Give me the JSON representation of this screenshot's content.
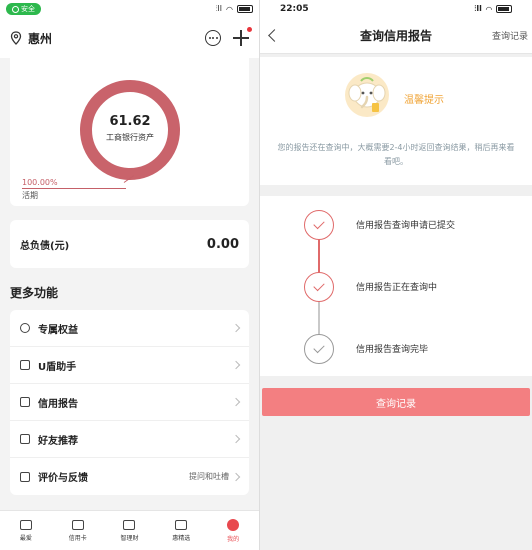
{
  "left": {
    "status": {
      "badge": "安全",
      "signal": "⫶ll",
      "wifi": "◠"
    },
    "header": {
      "location": "惠州"
    },
    "asset": {
      "value": "61.62",
      "label": "工商银行资产",
      "percent": "100.00%",
      "type": "活期",
      "ring_fraction": 1.0
    },
    "debt": {
      "label": "总负债(元)",
      "value": "0.00"
    },
    "more_title": "更多功能",
    "menu": [
      {
        "label": "专属权益",
        "extra": ""
      },
      {
        "label": "U盾助手",
        "extra": ""
      },
      {
        "label": "信用报告",
        "extra": ""
      },
      {
        "label": "好友推荐",
        "extra": ""
      },
      {
        "label": "评价与反馈",
        "extra": "提问和吐槽"
      }
    ],
    "tabs": [
      {
        "label": "最爱",
        "active": false
      },
      {
        "label": "信用卡",
        "active": false
      },
      {
        "label": "智理财",
        "active": false
      },
      {
        "label": "惠精选",
        "active": false
      },
      {
        "label": "我的",
        "active": true
      }
    ]
  },
  "right": {
    "status": {
      "time": "22:05"
    },
    "header": {
      "title": "查询信用报告",
      "record_link": "查询记录"
    },
    "tip": {
      "title": "温馨提示",
      "text": "您的报告还在查询中，大概需要2-4小时返回查询结果，稍后再来看看吧。"
    },
    "steps": [
      {
        "label": "信用报告查询申请已提交"
      },
      {
        "label": "信用报告正在查询中"
      },
      {
        "label": "信用报告查询完毕"
      }
    ],
    "button": "查询记录"
  },
  "colors": {
    "accent_red": "#e06a6a",
    "button_red": "#f37f81",
    "tip_orange": "#f0a437",
    "safe_green": "#2db84d"
  }
}
